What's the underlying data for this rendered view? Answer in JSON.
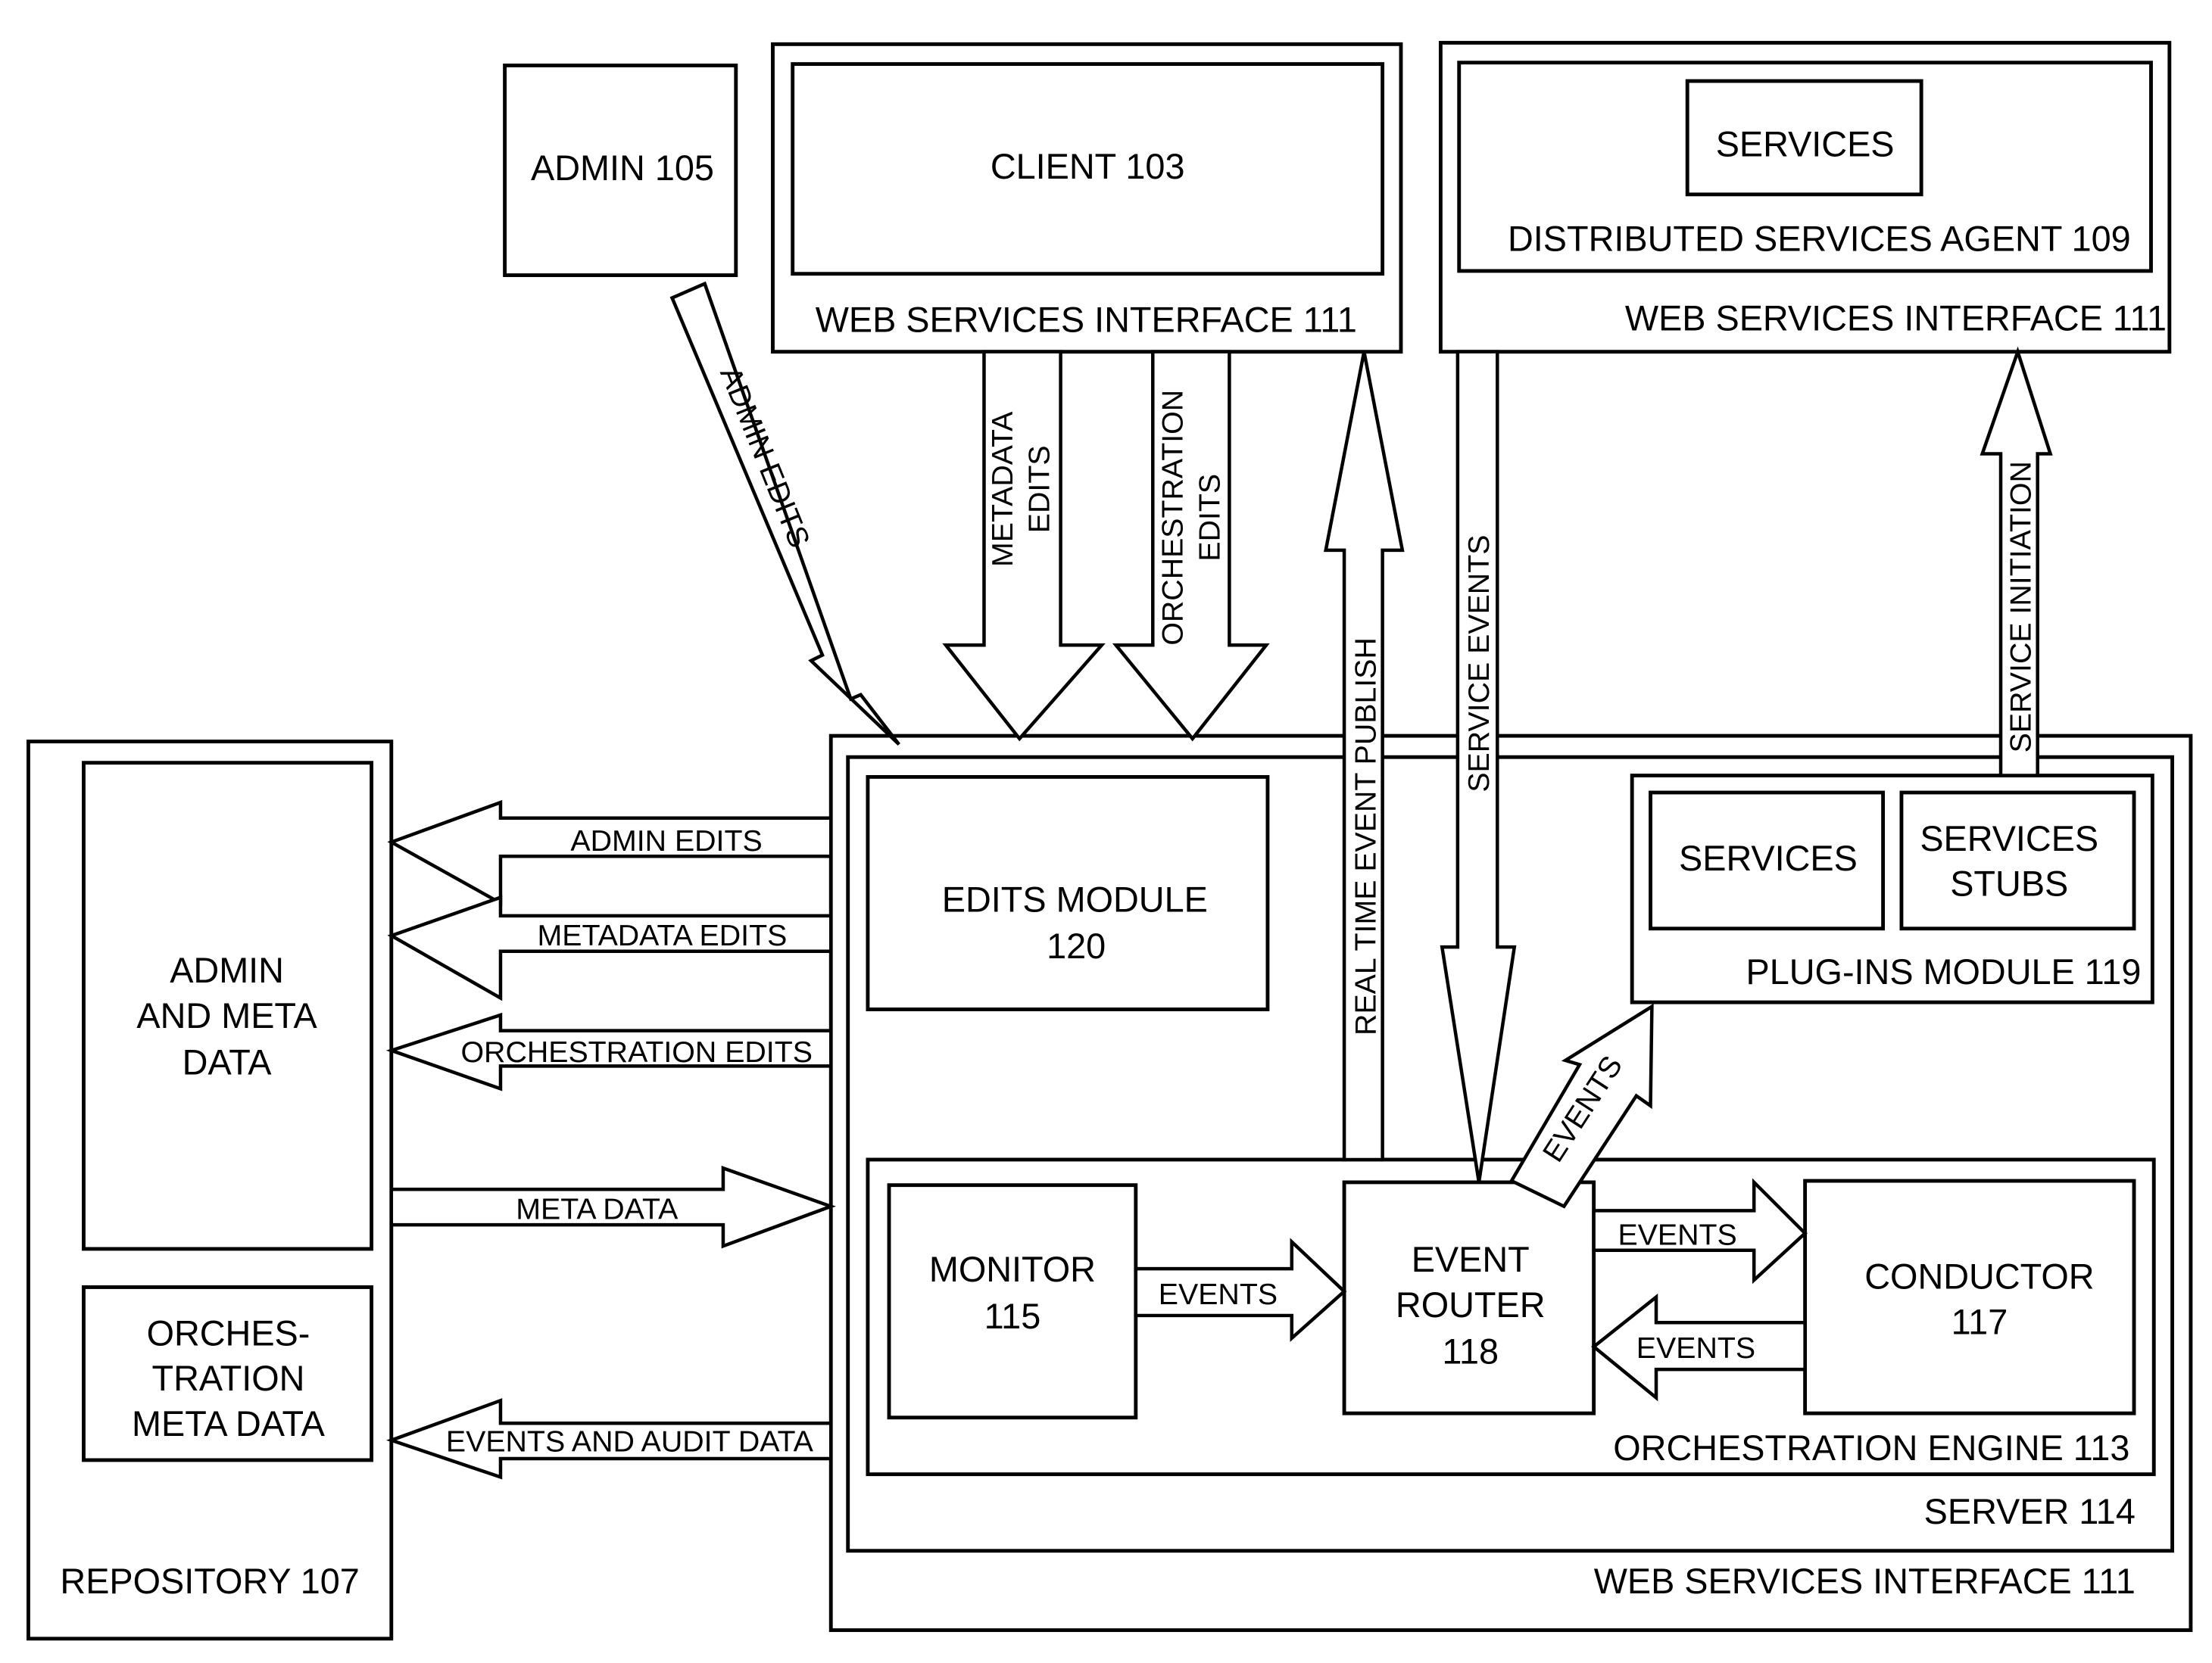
{
  "figure": {
    "colors": {
      "ink": "#000000",
      "paper": "#ffffff"
    },
    "blocks": {
      "admin": "ADMIN 105",
      "client": "CLIENT 103",
      "client_wsi": "WEB SERVICES INTERFACE 111",
      "dsa_services": "SERVICES",
      "dsa": "DISTRIBUTED SERVICES AGENT 109",
      "dsa_wsi": "WEB SERVICES INTERFACE 111",
      "repository": "REPOSITORY 107",
      "admin_meta_lines": [
        "ADMIN",
        "AND META",
        "DATA"
      ],
      "orch_meta_lines": [
        "ORCHES-",
        "TRATION",
        "META DATA"
      ],
      "edits_module_lines": [
        "EDITS MODULE",
        "120"
      ],
      "plugin_services": "SERVICES",
      "plugin_stubs_lines": [
        "SERVICES",
        "STUBS"
      ],
      "plugins": "PLUG-INS MODULE 119",
      "monitor_lines": [
        "MONITOR",
        "115"
      ],
      "router_lines": [
        "EVENT",
        "ROUTER",
        "118"
      ],
      "conductor_lines": [
        "CONDUCTOR",
        "117"
      ],
      "engine": "ORCHESTRATION ENGINE 113",
      "server": "SERVER 114",
      "server_wsi": "WEB SERVICES INTERFACE 111"
    },
    "arrows": {
      "admin_edits_diag": "ADMIN EDITS",
      "metadata_edits_down_lines": [
        "METADATA",
        "EDITS"
      ],
      "orchestration_edits_down_lines": [
        "ORCHESTRATION",
        "EDITS"
      ],
      "real_time_publish": "REAL TIME EVENT PUBLISH",
      "service_events": "SERVICE EVENTS",
      "service_initiation": "SERVICE INITIATION",
      "repo_admin_edits": "ADMIN EDITS",
      "repo_metadata_edits": "METADATA EDITS",
      "repo_orchestration_edits": "ORCHESTRATION EDITS",
      "repo_meta_data": "META DATA",
      "repo_events_audit": "EVENTS AND AUDIT DATA",
      "router_to_plugins": "EVENTS",
      "monitor_to_router": "EVENTS",
      "router_to_conductor": "EVENTS",
      "conductor_to_router": "EVENTS"
    }
  }
}
